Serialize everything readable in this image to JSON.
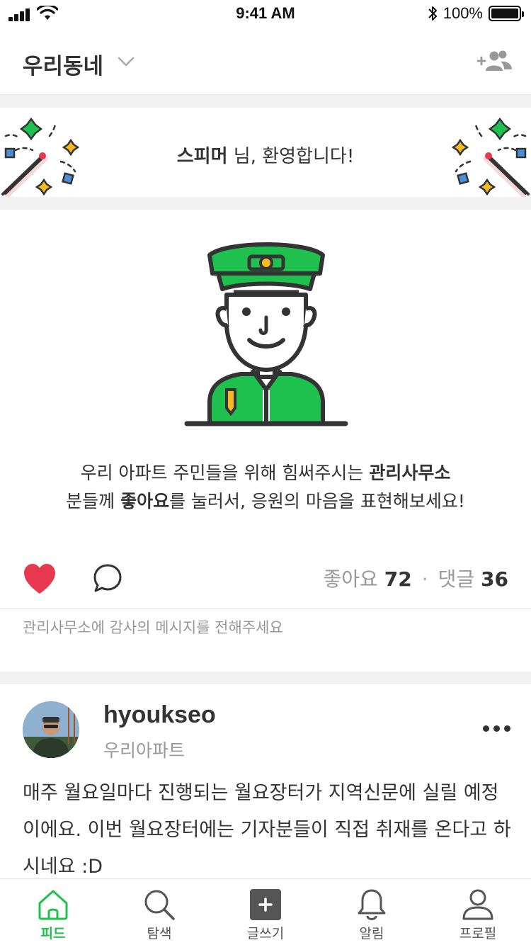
{
  "status_bar": {
    "time": "9:41 AM",
    "battery_pct": "100%"
  },
  "header": {
    "title": "우리동네"
  },
  "welcome": {
    "name": "스피머",
    "suffix": " 님, 환영합니다!"
  },
  "card": {
    "line1_prefix": "우리 아파트 주민들을 위해 힘써주시는 ",
    "line1_bold": "관리사무소",
    "line2_prefix": "분들께 ",
    "line2_bold": "좋아요",
    "line2_suffix": "를 눌러서, 응원의 마음을 표현해보세요!",
    "likes_label": "좋아요",
    "likes_count": "72",
    "separator": "·",
    "comments_label": "댓글",
    "comments_count": "36",
    "comment_hint": "관리사무소에 감사의 메시지를 전해주세요"
  },
  "post": {
    "author": "hyoukseo",
    "location": "우리아파트",
    "body": "매주 월요일마다 진행되는 월요장터가 지역신문에 실릴 예정이에요. 이번 월요장터에는 기자분들이 직접 취재를 온다고 하시네요 :D"
  },
  "tabs": [
    {
      "label": "피드",
      "icon": "home-icon",
      "active": true
    },
    {
      "label": "탐색",
      "icon": "search-icon",
      "active": false
    },
    {
      "label": "글쓰기",
      "icon": "plus-square-icon",
      "active": false
    },
    {
      "label": "알림",
      "icon": "bell-icon",
      "active": false
    },
    {
      "label": "프로필",
      "icon": "profile-icon",
      "active": false
    }
  ],
  "colors": {
    "accent": "#1ec04e",
    "heart": "#e8384f",
    "text": "#333333",
    "muted": "#999999"
  }
}
